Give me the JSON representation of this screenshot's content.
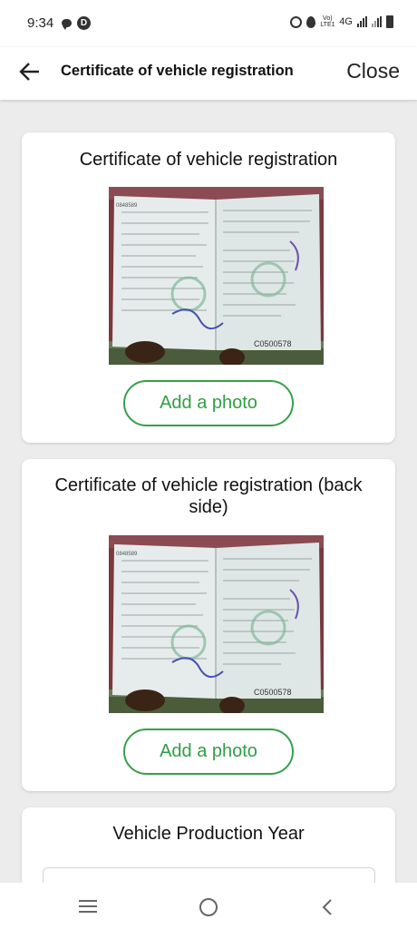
{
  "status_bar": {
    "time": "9:34",
    "badge": "D",
    "network": "4G",
    "volte": "Vo) LTE1"
  },
  "header": {
    "title": "Certificate of vehicle registration",
    "close_label": "Close",
    "back_icon": "arrow-left-icon"
  },
  "cards": [
    {
      "title": "Certificate of vehicle registration",
      "button_label": "Add a photo",
      "photo_alt": "Photo of vehicle registration certificate",
      "doc_number": "C0500578",
      "serial": "0848589"
    },
    {
      "title": "Certificate of vehicle registration (back side)",
      "button_label": "Add a photo",
      "photo_alt": "Photo of vehicle registration certificate back side",
      "doc_number": "C0500578",
      "serial": "0848589"
    }
  ],
  "year_card": {
    "title": "Vehicle Production Year"
  },
  "colors": {
    "accent_green": "#34a14a",
    "background": "#ececec",
    "card": "#ffffff"
  },
  "nav_icons": [
    "recent-apps-icon",
    "home-icon",
    "back-icon"
  ]
}
